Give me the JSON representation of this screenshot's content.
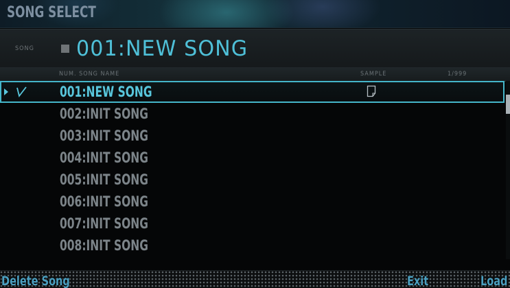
{
  "title": "SONG SELECT",
  "song_header": {
    "label": "SONG",
    "current_song": "001:NEW SONG"
  },
  "columns": {
    "num_song_name": "NUM. SONG NAME",
    "sample": "SAMPLE",
    "page": "1/999"
  },
  "songs": [
    {
      "name": "001:NEW SONG",
      "selected": true,
      "checked": true,
      "has_sample": true
    },
    {
      "name": "002:INIT SONG"
    },
    {
      "name": "003:INIT SONG"
    },
    {
      "name": "004:INIT SONG"
    },
    {
      "name": "005:INIT SONG"
    },
    {
      "name": "006:INIT SONG"
    },
    {
      "name": "007:INIT SONG"
    },
    {
      "name": "008:INIT SONG"
    }
  ],
  "footer": {
    "delete_label": "Delete Song",
    "exit_label": "Exit",
    "load_label": "Load"
  },
  "icons": {
    "cursor": "cursor-arrow-icon",
    "check": "check-icon",
    "sample": "document-icon",
    "song_status": "square-icon"
  },
  "colors": {
    "accent": "#58c6dc",
    "inactive_text": "#7c8489",
    "footer_text": "#4b9fc0"
  }
}
